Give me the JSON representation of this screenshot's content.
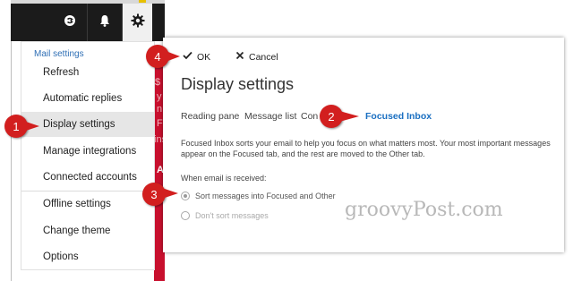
{
  "menu": {
    "header": "Mail settings",
    "items": [
      {
        "label": "Refresh"
      },
      {
        "label": "Automatic replies"
      },
      {
        "label": "Display settings"
      },
      {
        "label": "Manage integrations"
      },
      {
        "label": "Connected accounts"
      },
      {
        "label": "Offline settings"
      },
      {
        "label": "Change theme"
      },
      {
        "label": "Options"
      }
    ]
  },
  "ad_strip": {
    "chars": [
      "$",
      "y",
      "n",
      "F",
      "ins",
      "A"
    ]
  },
  "panel": {
    "ok_label": "OK",
    "cancel_label": "Cancel",
    "title": "Display settings",
    "tabs": [
      {
        "label": "Reading pane"
      },
      {
        "label": "Message list"
      },
      {
        "label": "Con"
      },
      {
        "label": "Focused Inbox"
      }
    ],
    "description": "Focused Inbox sorts your email to help you focus on what matters most. Your most important messages appear on the Focused tab, and the rest are moved to the Other tab.",
    "email_label": "When email is received:",
    "options": [
      {
        "label": "Sort messages into Focused and Other"
      },
      {
        "label": "Don't sort messages"
      }
    ]
  },
  "watermark": "groovyPost.com",
  "callouts": [
    "1",
    "2",
    "3",
    "4"
  ],
  "colors": {
    "accent_blue": "#1a6fc1",
    "callout_red": "#d21f1f",
    "ad_red": "#c8102e"
  },
  "icons": {
    "topbar": [
      "skype-icon",
      "bell-icon",
      "gear-icon"
    ],
    "actions": [
      "checkmark-icon",
      "x-icon"
    ]
  }
}
